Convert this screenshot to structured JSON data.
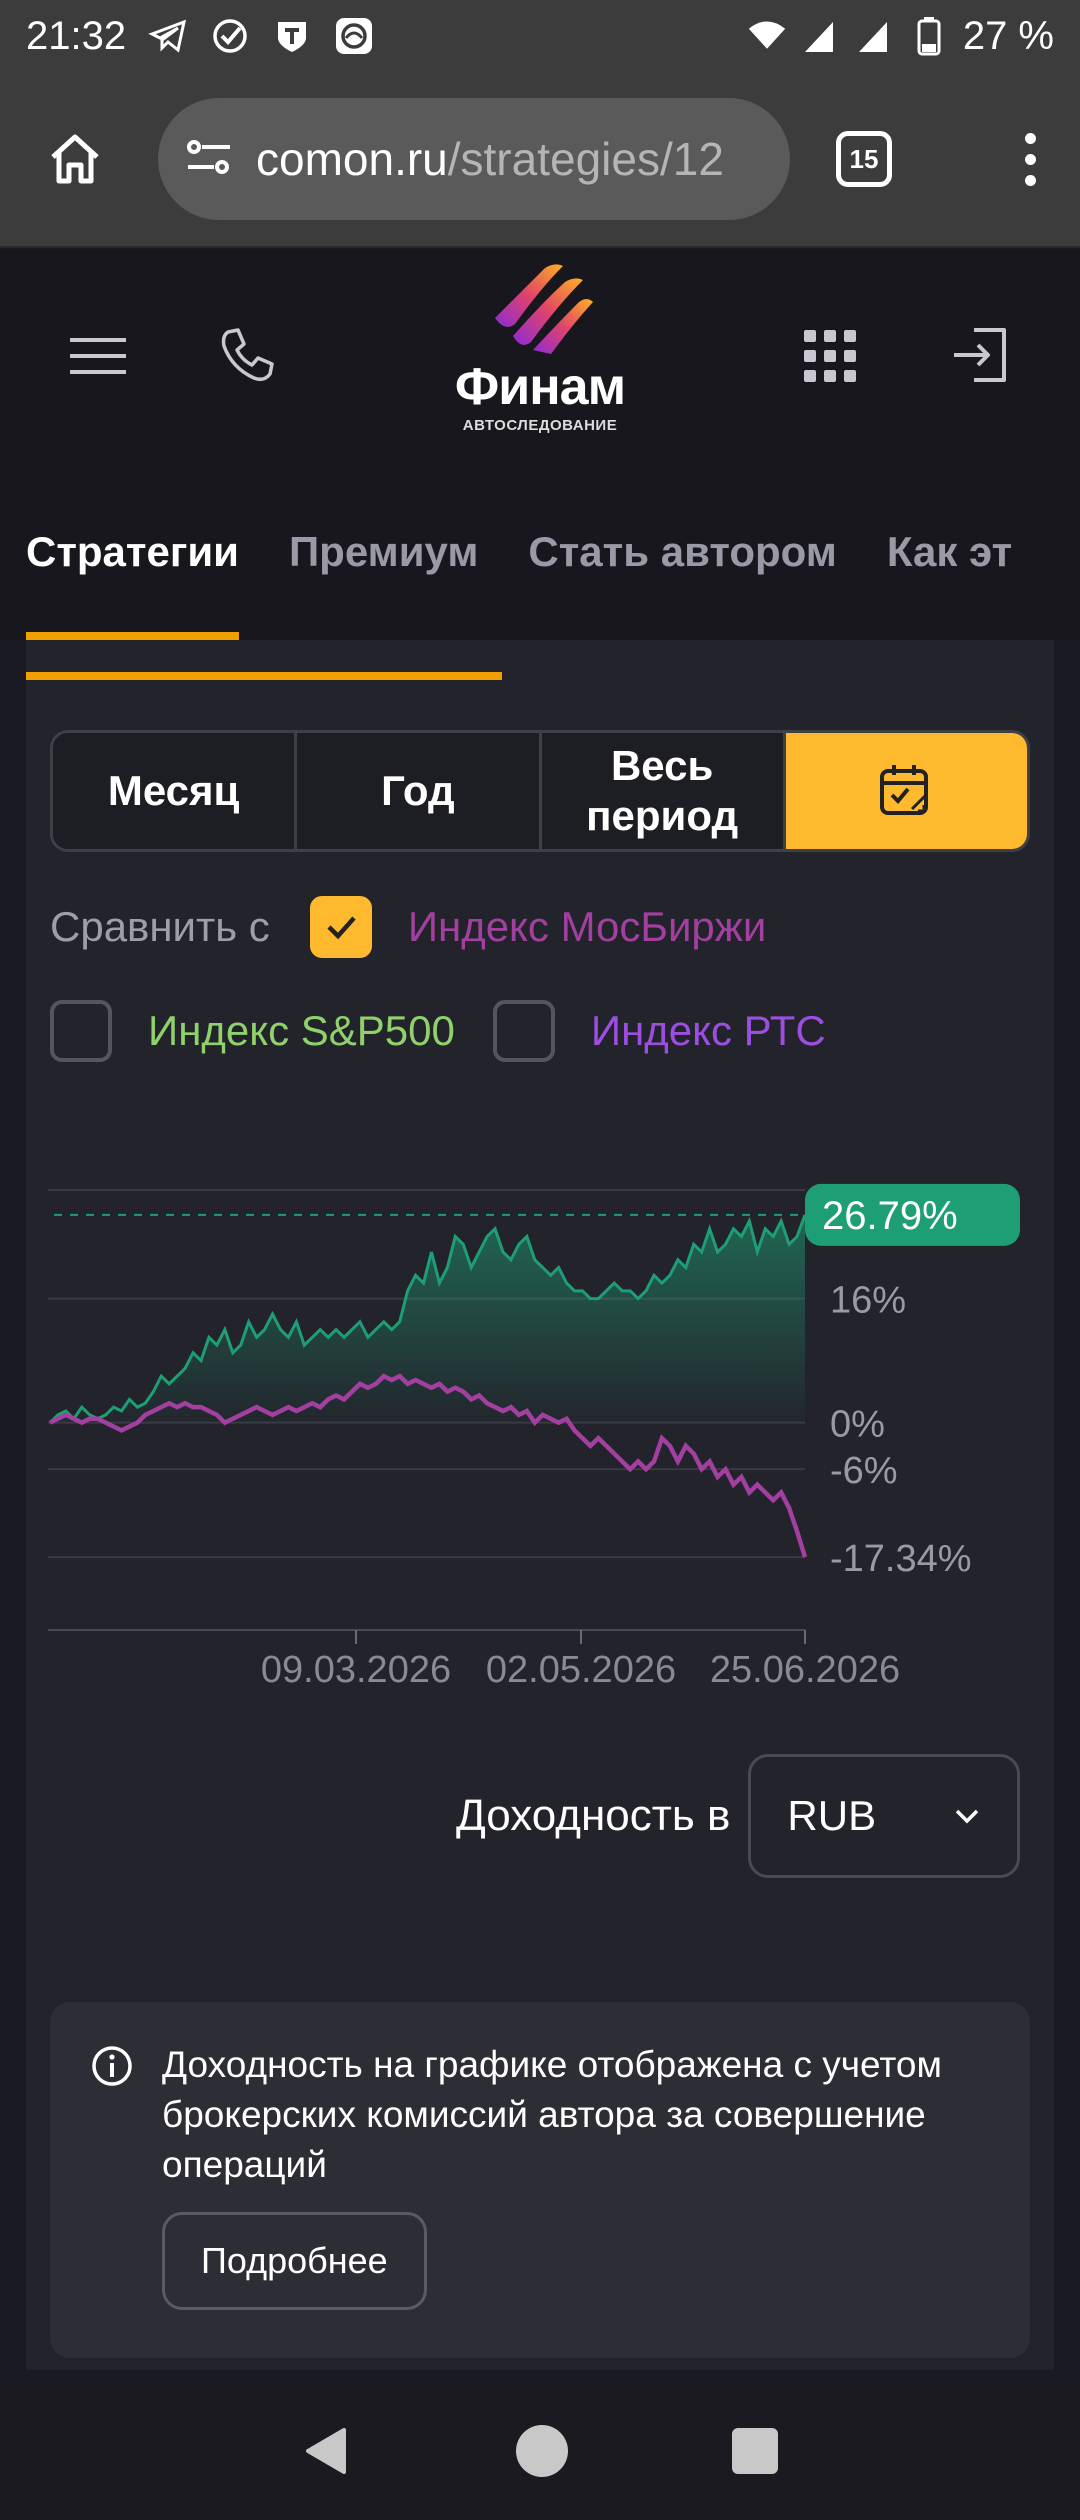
{
  "status_bar": {
    "time": "21:32",
    "battery": "27 %"
  },
  "browser": {
    "url_host": "comon.ru",
    "url_path": "/strategies/12",
    "tab_count": "15"
  },
  "site": {
    "logo_name": "Финам",
    "logo_sub": "АВТОСЛЕДОВАНИЕ",
    "nav_tabs": [
      "Стратегии",
      "Премиум",
      "Стать автором",
      "Как эт"
    ]
  },
  "period": {
    "month": "Месяц",
    "year": "Год",
    "all_line1": "Весь",
    "all_line2": "период"
  },
  "compare": {
    "label": "Сравнить с",
    "moex": "Индекс МосБиржи",
    "sp500": "Индекс S&P500",
    "rts": "Индекс РТС",
    "moex_checked": true,
    "sp500_checked": false,
    "rts_checked": false
  },
  "colors": {
    "accent": "#ffb92e",
    "strategy": "#1e9e74",
    "moex": "#a23fa0",
    "sp500": "#8fd16a",
    "rts": "#9b4ee0"
  },
  "chart_data": {
    "type": "line",
    "x_ticks": [
      "09.03.2026",
      "02.05.2026",
      "25.06.2026"
    ],
    "y_ticks": [
      "16%",
      "0%",
      "-6%"
    ],
    "end_labels": {
      "strategy": "26.79%",
      "moex": "-17.34%"
    },
    "series": [
      {
        "name": "strategy",
        "values": [
          0,
          1,
          1.5,
          0.5,
          2,
          1,
          0.5,
          1,
          2,
          1.5,
          3,
          2,
          2.5,
          4,
          6,
          5,
          6,
          7,
          9,
          8,
          11,
          10,
          12,
          9,
          10,
          13,
          11,
          12,
          14,
          12,
          11,
          13,
          10,
          11,
          12,
          11,
          12,
          11,
          12,
          13,
          11,
          12,
          13,
          12,
          13,
          17,
          19,
          18,
          22,
          18,
          20,
          24,
          23,
          20,
          22,
          24,
          25,
          22,
          21,
          23,
          24,
          21,
          20,
          19,
          20,
          18,
          17,
          17,
          16,
          16,
          17,
          18,
          17,
          17,
          16,
          17,
          19,
          18,
          19,
          21,
          20,
          23,
          22,
          25,
          22,
          23,
          25,
          24,
          26,
          22,
          25,
          24,
          26,
          23,
          24,
          26.79
        ]
      },
      {
        "name": "moex",
        "values": [
          0,
          0.5,
          1,
          0.5,
          0,
          0.5,
          0.5,
          0,
          -0.5,
          -1,
          -0.5,
          0,
          1,
          1.5,
          2,
          2.5,
          2,
          2.5,
          2,
          2,
          1.5,
          1,
          0,
          0.5,
          1,
          1.5,
          2,
          1.5,
          1,
          1.5,
          2,
          1.5,
          2,
          2.5,
          2,
          3,
          3.5,
          3,
          4,
          5,
          4.5,
          5,
          6,
          5.5,
          6,
          5,
          5.5,
          5,
          4.5,
          5,
          4,
          4.5,
          4,
          3,
          3.5,
          2.5,
          2,
          1.5,
          2,
          1,
          1.5,
          0,
          1,
          0.5,
          0,
          0.5,
          -1,
          -2,
          -3,
          -2,
          -3,
          -4,
          -5,
          -6,
          -5,
          -6,
          -5,
          -2,
          -3,
          -5,
          -3,
          -4,
          -6,
          -5,
          -7,
          -6,
          -8,
          -7,
          -9,
          -8,
          -9,
          -10,
          -9,
          -11,
          -14,
          -17.34
        ]
      }
    ],
    "baseline": 0
  },
  "currency": {
    "label": "Доходность в",
    "value": "RUB"
  },
  "info": {
    "text": "Доходность на графике отображена с учетом брокерских комиссий автора за совершение операций",
    "button": "Подробнее"
  }
}
